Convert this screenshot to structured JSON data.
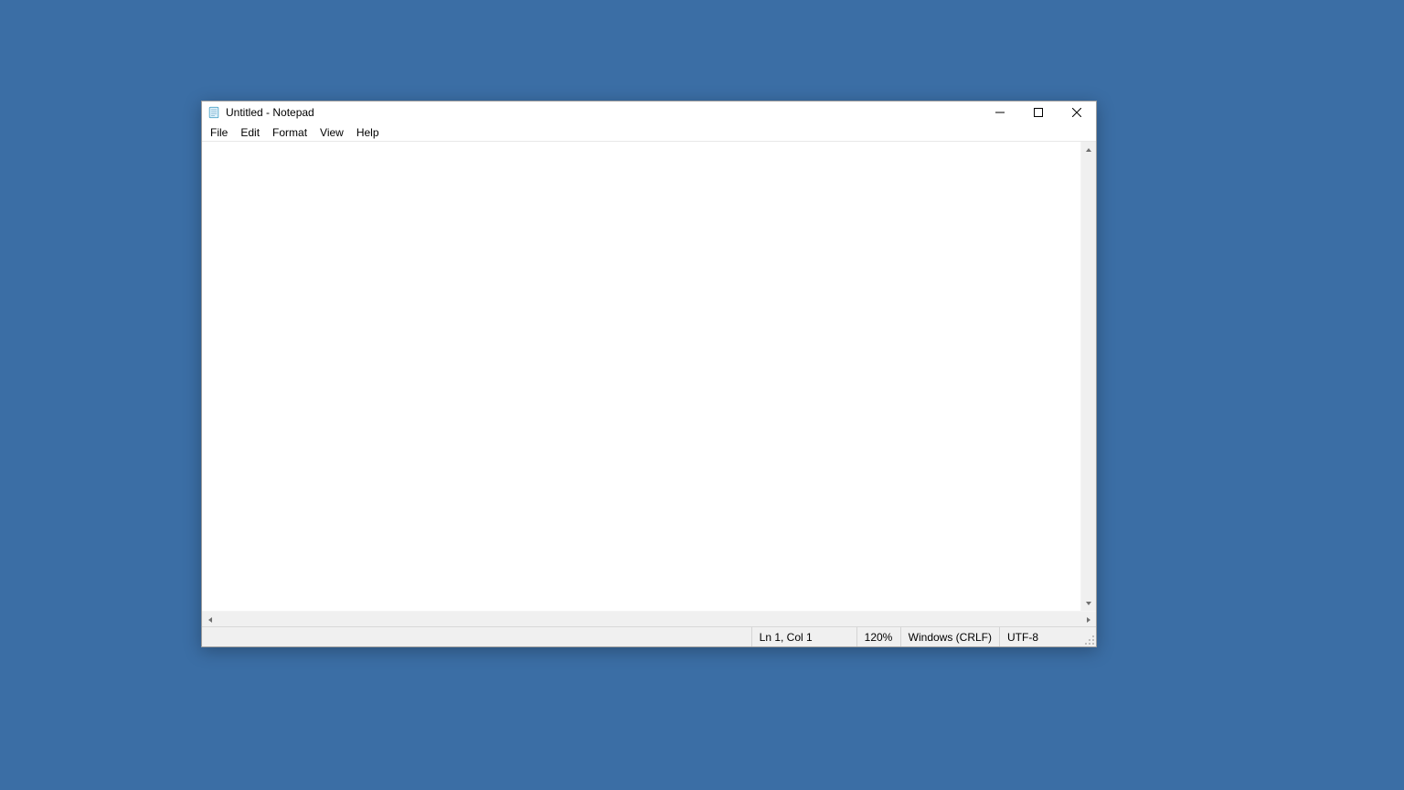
{
  "titlebar": {
    "title": "Untitled - Notepad"
  },
  "menu": {
    "items": [
      "File",
      "Edit",
      "Format",
      "View",
      "Help"
    ]
  },
  "editor": {
    "content": ""
  },
  "statusbar": {
    "position": "Ln 1, Col 1",
    "zoom": "120%",
    "eol": "Windows (CRLF)",
    "encoding": "UTF-8"
  }
}
